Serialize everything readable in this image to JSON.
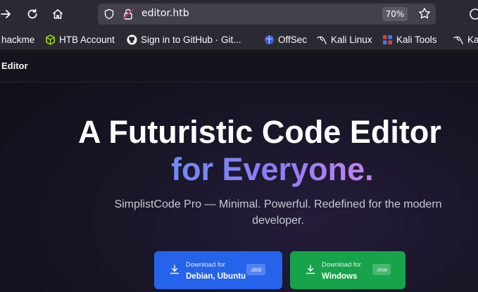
{
  "browser": {
    "url": "editor.htb",
    "zoom": "70%",
    "icons": [
      "forward-icon",
      "reload-icon",
      "home-icon",
      "shield-icon",
      "insecure-lock-icon",
      "bookmark-star-icon",
      "extension-icon"
    ]
  },
  "bookmarks": [
    {
      "label": "hackme",
      "icon": "none"
    },
    {
      "label": "HTB Account",
      "icon": "htb-cube-icon"
    },
    {
      "label": "Sign in to GitHub · Git...",
      "icon": "github-icon"
    },
    {
      "label": "OffSec",
      "icon": "offsec-icon"
    },
    {
      "label": "Kali Linux",
      "icon": "kali-dragon-icon"
    },
    {
      "label": "Kali Tools",
      "icon": "kali-tools-icon"
    },
    {
      "label": "Kal",
      "icon": "kali-dragon-icon"
    }
  ],
  "site": {
    "logo": "Editor",
    "hero_line1": "A Futuristic Code Editor",
    "hero_line2": "for Everyone.",
    "subtitle": "SimplistCode Pro — Minimal. Powerful. Redefined for the modern developer.",
    "downloads": [
      {
        "small": "Download for",
        "main": "Debian, Ubuntu",
        "tag": ".deb",
        "color": "#2563eb"
      },
      {
        "small": "Download for",
        "main": "Windows",
        "tag": ".exe",
        "color": "#16a34a"
      }
    ]
  },
  "colors": {
    "toolbar": "#2b2a33",
    "urlbar": "#42414d",
    "page_bg": "#161423",
    "gradient_start": "#6b8cf6",
    "gradient_end": "#c585ef"
  }
}
